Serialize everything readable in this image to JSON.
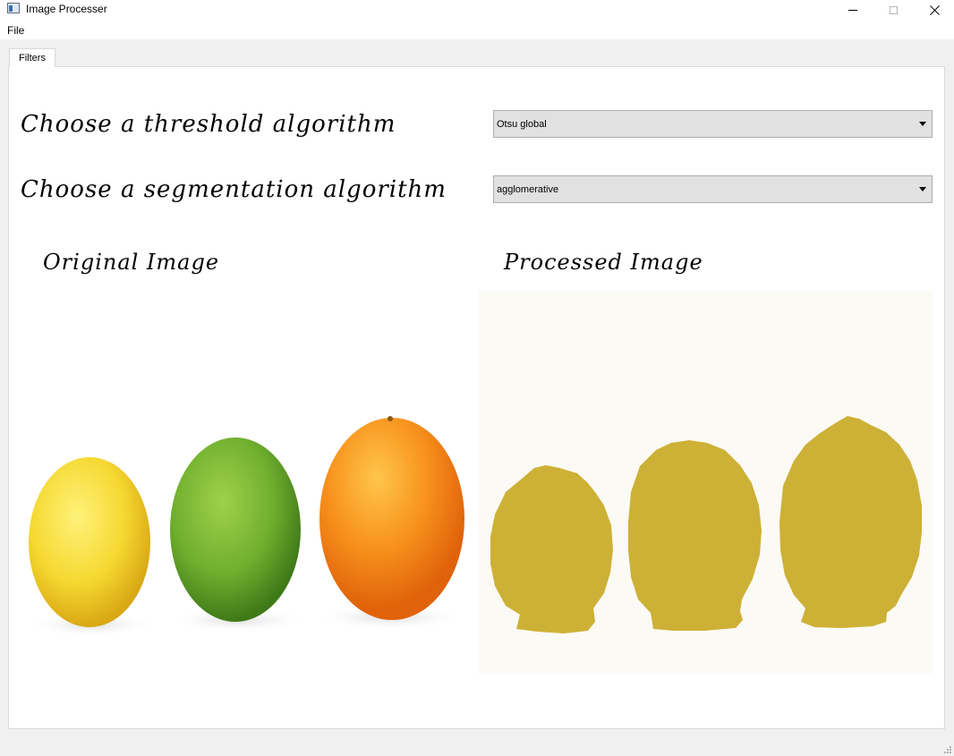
{
  "window": {
    "title": "Image Processer"
  },
  "menubar": {
    "items": [
      "File"
    ]
  },
  "tabs": [
    {
      "label": "Filters",
      "selected": true
    }
  ],
  "filters": {
    "threshold_label": "Choose a threshold algorithm",
    "threshold_value": "Otsu global",
    "segmentation_label": "Choose a segmentation algorithm",
    "segmentation_value": "agglomerative",
    "original_label": "Original Image",
    "processed_label": "Processed Image"
  },
  "colors": {
    "lemon": "#f5d830",
    "lime": "#6fae2e",
    "orange": "#f7901c",
    "segment_fill": "#cdb136",
    "processed_bg": "#fcfaf5"
  },
  "icons": {
    "app": "app-window-icon",
    "minimize": "minimize-icon",
    "maximize": "maximize-icon",
    "close": "close-icon",
    "dropdown": "chevron-down-icon"
  }
}
